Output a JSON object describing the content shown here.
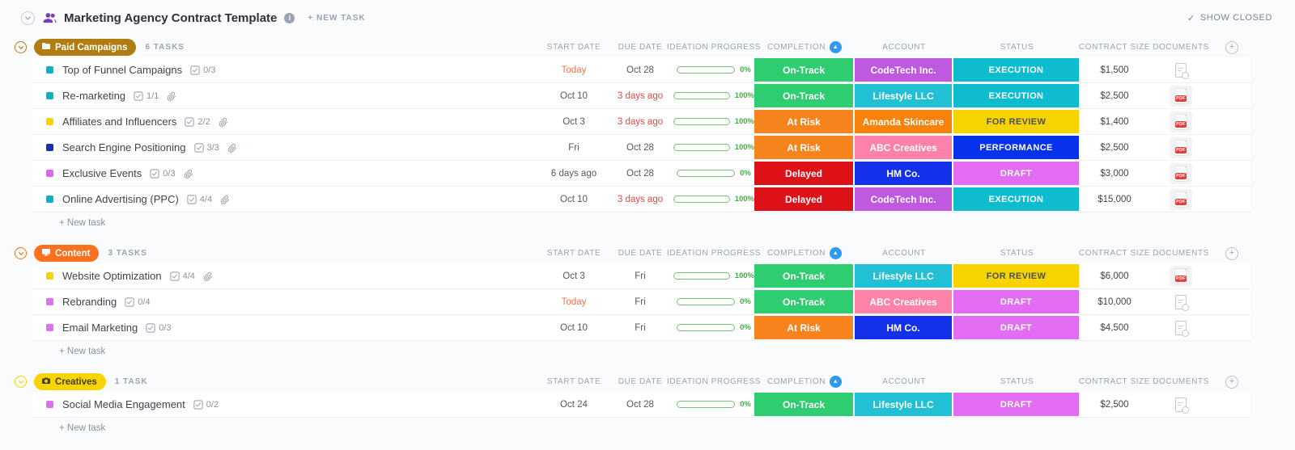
{
  "header": {
    "title": "Marketing Agency Contract Template",
    "info_glyph": "i",
    "new_task_label": "+ NEW TASK",
    "check_glyph": "✓",
    "show_closed_label": "SHOW CLOSED"
  },
  "columns": [
    "START DATE",
    "DUE DATE",
    "IDEATION PROGRESS",
    "COMPLETION",
    "ACCOUNT",
    "STATUS",
    "CONTRACT SIZE",
    "DOCUMENTS"
  ],
  "sorted_column": "COMPLETION",
  "sort_glyph": "▲",
  "add_column_glyph": "+",
  "pdf_label": "PDF",
  "palette": {
    "on_track": "#2ecd6f",
    "at_risk": "#f7831c",
    "delayed": "#dc1218",
    "status_execution": "#0fbccf",
    "status_for_review": "#f7d400",
    "status_performance": "#0532ea",
    "status_draft": "#e26df2",
    "account_purple": "#bf5ae0",
    "account_cyan": "#22c0d4",
    "account_orange": "#f8820a",
    "account_pink": "#ff82ab",
    "account_blue": "#1430e8"
  },
  "groups": [
    {
      "name": "Paid Campaigns",
      "count_label": "6 TASKS",
      "color": "#b17d11",
      "text_color": "#ffffff",
      "icon": "folder",
      "new_task_label": "+ New task",
      "tasks": [
        {
          "name": "Top of Funnel Campaigns",
          "bullet": "#0cb2c2",
          "checklist": "0/3",
          "attachment": false,
          "start": {
            "text": "Today",
            "tone": "today"
          },
          "due": {
            "text": "Oct 28",
            "tone": "normal"
          },
          "progress": {
            "pct": 0,
            "label": "0%"
          },
          "completion": {
            "label": "On-Track",
            "bg": "#2ecd6f"
          },
          "account": {
            "label": "CodeTech Inc.",
            "bg": "#bf5ae0"
          },
          "status": {
            "label": "EXECUTION",
            "bg": "#0fbccf",
            "fg": "#ffffff"
          },
          "contract": "$1,500",
          "document": "placeholder"
        },
        {
          "name": "Re-marketing",
          "bullet": "#0cb2c2",
          "checklist": "1/1",
          "attachment": true,
          "start": {
            "text": "Oct 10",
            "tone": "normal"
          },
          "due": {
            "text": "3 days ago",
            "tone": "overdue"
          },
          "progress": {
            "pct": 100,
            "label": "100%"
          },
          "completion": {
            "label": "On-Track",
            "bg": "#2ecd6f"
          },
          "account": {
            "label": "Lifestyle LLC",
            "bg": "#22c0d4"
          },
          "status": {
            "label": "EXECUTION",
            "bg": "#0fbccf",
            "fg": "#ffffff"
          },
          "contract": "$2,500",
          "document": "pdf"
        },
        {
          "name": "Affiliates and Influencers",
          "bullet": "#f7d303",
          "checklist": "2/2",
          "attachment": true,
          "start": {
            "text": "Oct 3",
            "tone": "normal"
          },
          "due": {
            "text": "3 days ago",
            "tone": "overdue"
          },
          "progress": {
            "pct": 100,
            "label": "100%"
          },
          "completion": {
            "label": "At Risk",
            "bg": "#f7831c"
          },
          "account": {
            "label": "Amanda Skincare",
            "bg": "#f8820a"
          },
          "status": {
            "label": "FOR REVIEW",
            "bg": "#f7d400",
            "fg": "#4b4f59"
          },
          "contract": "$1,400",
          "document": "pdf"
        },
        {
          "name": "Search Engine Positioning",
          "bullet": "#1b2da8",
          "checklist": "3/3",
          "attachment": true,
          "start": {
            "text": "Fri",
            "tone": "normal"
          },
          "due": {
            "text": "Oct 28",
            "tone": "normal"
          },
          "progress": {
            "pct": 100,
            "label": "100%"
          },
          "completion": {
            "label": "At Risk",
            "bg": "#f7831c"
          },
          "account": {
            "label": "ABC Creatives",
            "bg": "#ff82ab"
          },
          "status": {
            "label": "PERFORMANCE",
            "bg": "#0532ea",
            "fg": "#ffffff"
          },
          "contract": "$2,500",
          "document": "pdf"
        },
        {
          "name": "Exclusive Events",
          "bullet": "#e263ef",
          "checklist": "0/3",
          "attachment": true,
          "start": {
            "text": "6 days ago",
            "tone": "normal"
          },
          "due": {
            "text": "Oct 28",
            "tone": "normal"
          },
          "progress": {
            "pct": 0,
            "label": "0%"
          },
          "completion": {
            "label": "Delayed",
            "bg": "#dc1218"
          },
          "account": {
            "label": "HM Co.",
            "bg": "#1430e8"
          },
          "status": {
            "label": "DRAFT",
            "bg": "#e26df2",
            "fg": "#ffffff"
          },
          "contract": "$3,000",
          "document": "pdf"
        },
        {
          "name": "Online Advertising (PPC)",
          "bullet": "#0cb2c2",
          "checklist": "4/4",
          "attachment": true,
          "start": {
            "text": "Oct 10",
            "tone": "normal"
          },
          "due": {
            "text": "3 days ago",
            "tone": "overdue"
          },
          "progress": {
            "pct": 100,
            "label": "100%"
          },
          "completion": {
            "label": "Delayed",
            "bg": "#dc1218"
          },
          "account": {
            "label": "CodeTech Inc.",
            "bg": "#bf5ae0"
          },
          "status": {
            "label": "EXECUTION",
            "bg": "#0fbccf",
            "fg": "#ffffff"
          },
          "contract": "$15,000",
          "document": "pdf"
        }
      ]
    },
    {
      "name": "Content",
      "count_label": "3 TASKS",
      "color": "#fa7220",
      "text_color": "#ffffff",
      "icon": "monitor",
      "new_task_label": "+ New task",
      "tasks": [
        {
          "name": "Website Optimization",
          "bullet": "#f7d303",
          "checklist": "4/4",
          "attachment": true,
          "start": {
            "text": "Oct 3",
            "tone": "normal"
          },
          "due": {
            "text": "Fri",
            "tone": "normal"
          },
          "progress": {
            "pct": 100,
            "label": "100%"
          },
          "completion": {
            "label": "On-Track",
            "bg": "#2ecd6f"
          },
          "account": {
            "label": "Lifestyle LLC",
            "bg": "#22c0d4"
          },
          "status": {
            "label": "FOR REVIEW",
            "bg": "#f7d400",
            "fg": "#4b4f59"
          },
          "contract": "$6,000",
          "document": "pdf"
        },
        {
          "name": "Rebranding",
          "bullet": "#e06ef0",
          "checklist": "0/4",
          "attachment": false,
          "start": {
            "text": "Today",
            "tone": "today"
          },
          "due": {
            "text": "Fri",
            "tone": "normal"
          },
          "progress": {
            "pct": 0,
            "label": "0%"
          },
          "completion": {
            "label": "On-Track",
            "bg": "#2ecd6f"
          },
          "account": {
            "label": "ABC Creatives",
            "bg": "#ff82ab"
          },
          "status": {
            "label": "DRAFT",
            "bg": "#e26df2",
            "fg": "#ffffff"
          },
          "contract": "$10,000",
          "document": "placeholder"
        },
        {
          "name": "Email Marketing",
          "bullet": "#e06ef0",
          "checklist": "0/3",
          "attachment": false,
          "start": {
            "text": "Oct 10",
            "tone": "normal"
          },
          "due": {
            "text": "Fri",
            "tone": "normal"
          },
          "progress": {
            "pct": 0,
            "label": "0%"
          },
          "completion": {
            "label": "At Risk",
            "bg": "#f7831c"
          },
          "account": {
            "label": "HM Co.",
            "bg": "#1430e8"
          },
          "status": {
            "label": "DRAFT",
            "bg": "#e26df2",
            "fg": "#ffffff"
          },
          "contract": "$4,500",
          "document": "placeholder"
        }
      ]
    },
    {
      "name": "Creatives",
      "count_label": "1 TASK",
      "color": "#f7d502",
      "text_color": "#473e0e",
      "icon": "camera",
      "new_task_label": "+ New task",
      "tasks": [
        {
          "name": "Social Media Engagement",
          "bullet": "#e06ef0",
          "checklist": "0/2",
          "attachment": false,
          "start": {
            "text": "Oct 24",
            "tone": "normal"
          },
          "due": {
            "text": "Oct 28",
            "tone": "normal"
          },
          "progress": {
            "pct": 0,
            "label": "0%"
          },
          "completion": {
            "label": "On-Track",
            "bg": "#2ecd6f"
          },
          "account": {
            "label": "Lifestyle LLC",
            "bg": "#22c0d4"
          },
          "status": {
            "label": "DRAFT",
            "bg": "#e26df2",
            "fg": "#ffffff"
          },
          "contract": "$2,500",
          "document": "placeholder"
        }
      ]
    }
  ]
}
